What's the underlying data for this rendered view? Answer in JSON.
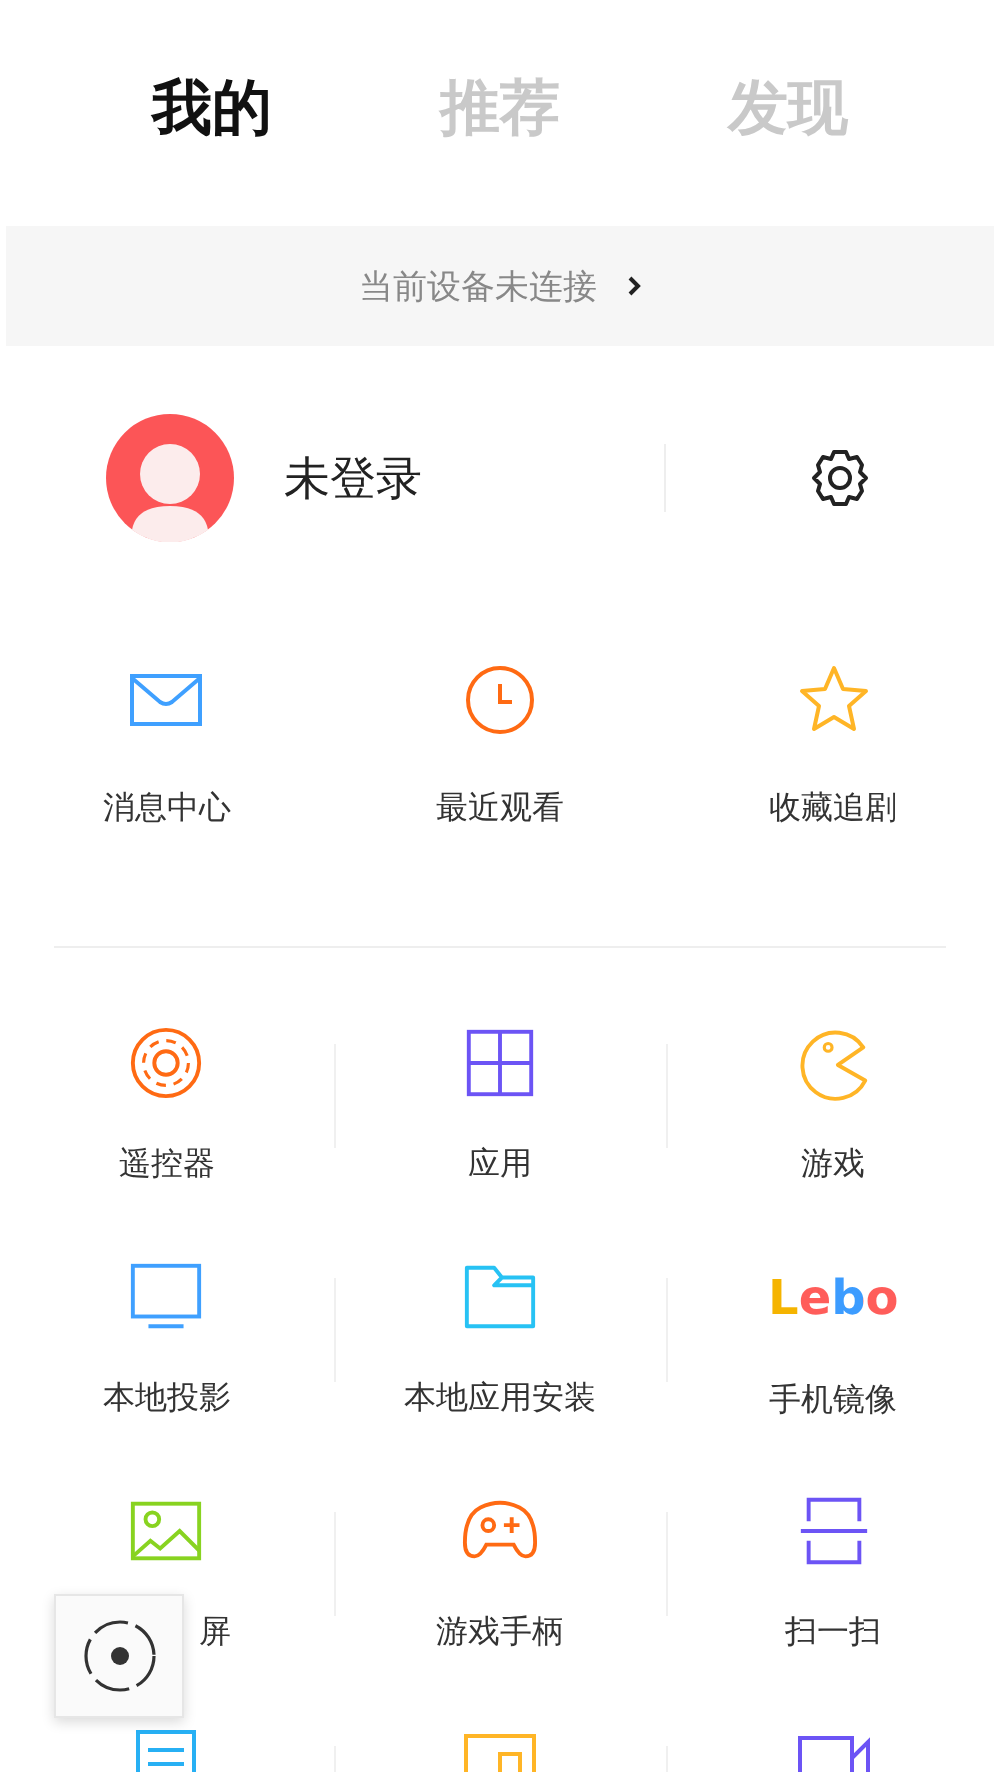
{
  "tabs": [
    {
      "label": "我的",
      "selected": true
    },
    {
      "label": "推荐",
      "selected": false
    },
    {
      "label": "发现",
      "selected": false
    }
  ],
  "device_bar": {
    "text": "当前设备未连接"
  },
  "profile": {
    "name": "未登录"
  },
  "quick_links": [
    {
      "label": "消息中心"
    },
    {
      "label": "最近观看"
    },
    {
      "label": "收藏追剧"
    }
  ],
  "features": [
    {
      "kind": "labeled",
      "label": "遥控器"
    },
    {
      "kind": "labeled",
      "label": "应用"
    },
    {
      "kind": "labeled",
      "label": "游戏"
    },
    {
      "kind": "labeled",
      "label": "本地投影"
    },
    {
      "kind": "labeled",
      "label": "本地应用安装"
    },
    {
      "kind": "logo",
      "label": "手机镜像",
      "logo": "Lebo"
    },
    {
      "kind": "labeled",
      "label": "屏",
      "clipped_start": true
    },
    {
      "kind": "labeled",
      "label": "游戏手柄"
    },
    {
      "kind": "labeled",
      "label": "扫一扫"
    },
    {
      "kind": "icon_only"
    },
    {
      "kind": "icon_only"
    },
    {
      "kind": "icon_only"
    }
  ]
}
